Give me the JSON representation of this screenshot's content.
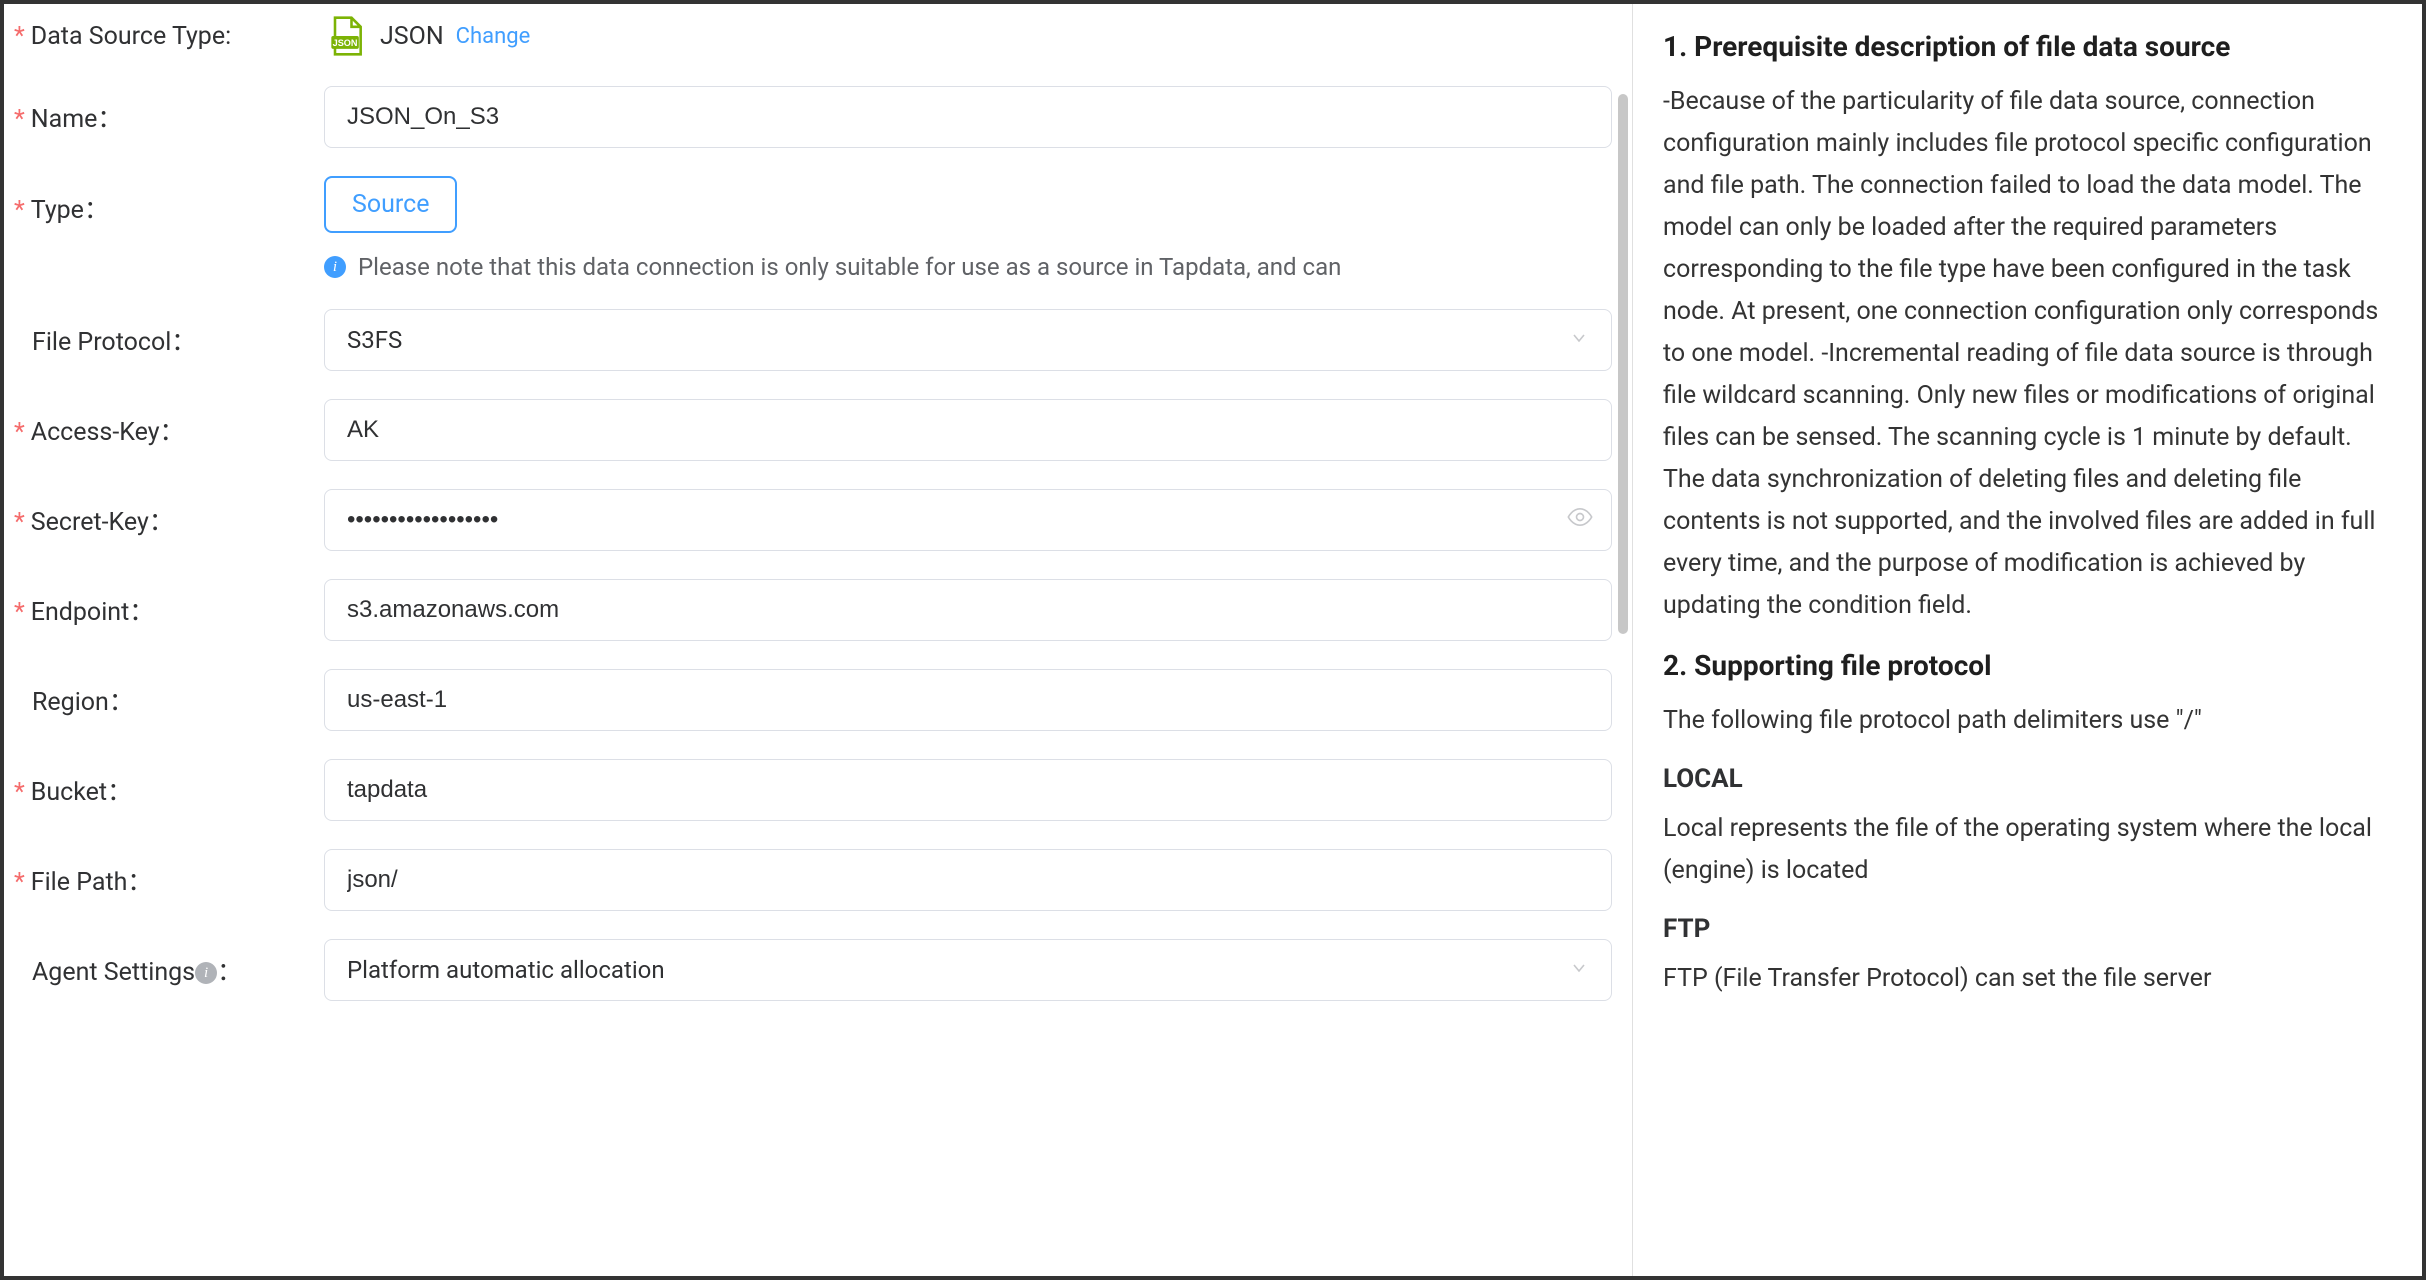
{
  "form": {
    "dataSourceType": {
      "label": "Data Source Type:",
      "value": "JSON",
      "changeLink": "Change"
    },
    "name": {
      "label": "Name：",
      "value": "JSON_On_S3"
    },
    "type": {
      "label": "Type：",
      "selected": "Source",
      "note": "Please note that this data connection is only suitable for use as a source in Tapdata, and can"
    },
    "fileProtocol": {
      "label": "File Protocol：",
      "value": "S3FS"
    },
    "accessKey": {
      "label": "Access-Key：",
      "value": "AK"
    },
    "secretKey": {
      "label": "Secret-Key：",
      "value": "••••••••••••••••••"
    },
    "endpoint": {
      "label": "Endpoint：",
      "value": "s3.amazonaws.com"
    },
    "region": {
      "label": "Region：",
      "value": "us-east-1"
    },
    "bucket": {
      "label": "Bucket：",
      "value": "tapdata"
    },
    "filePath": {
      "label": "File Path：",
      "value": "json/"
    },
    "agentSettings": {
      "label": "Agent Settings",
      "value": "Platform automatic allocation"
    }
  },
  "help": {
    "h1": "1. Prerequisite description of file data source",
    "p1": "-Because of the particularity of file data source, connection configuration mainly includes file protocol specific configuration and file path. The connection failed to load the data model. The model can only be loaded after the required parameters corresponding to the file type have been configured in the task node. At present, one connection configuration only corresponds to one model. -Incremental reading of file data source is through file wildcard scanning. Only new files or modifications of original files can be sensed. The scanning cycle is 1 minute by default. The data synchronization of deleting files and deleting file contents is not supported, and the involved files are added in full every time, and the purpose of modification is achieved by updating the condition field.",
    "h2": "2. Supporting file protocol",
    "p2": "The following file protocol path delimiters use \"/\"",
    "sub1": "LOCAL",
    "p3": "Local represents the file of the operating system where the local (engine) is located",
    "sub2": "FTP",
    "p4": "FTP (File Transfer Protocol) can set the file server"
  }
}
